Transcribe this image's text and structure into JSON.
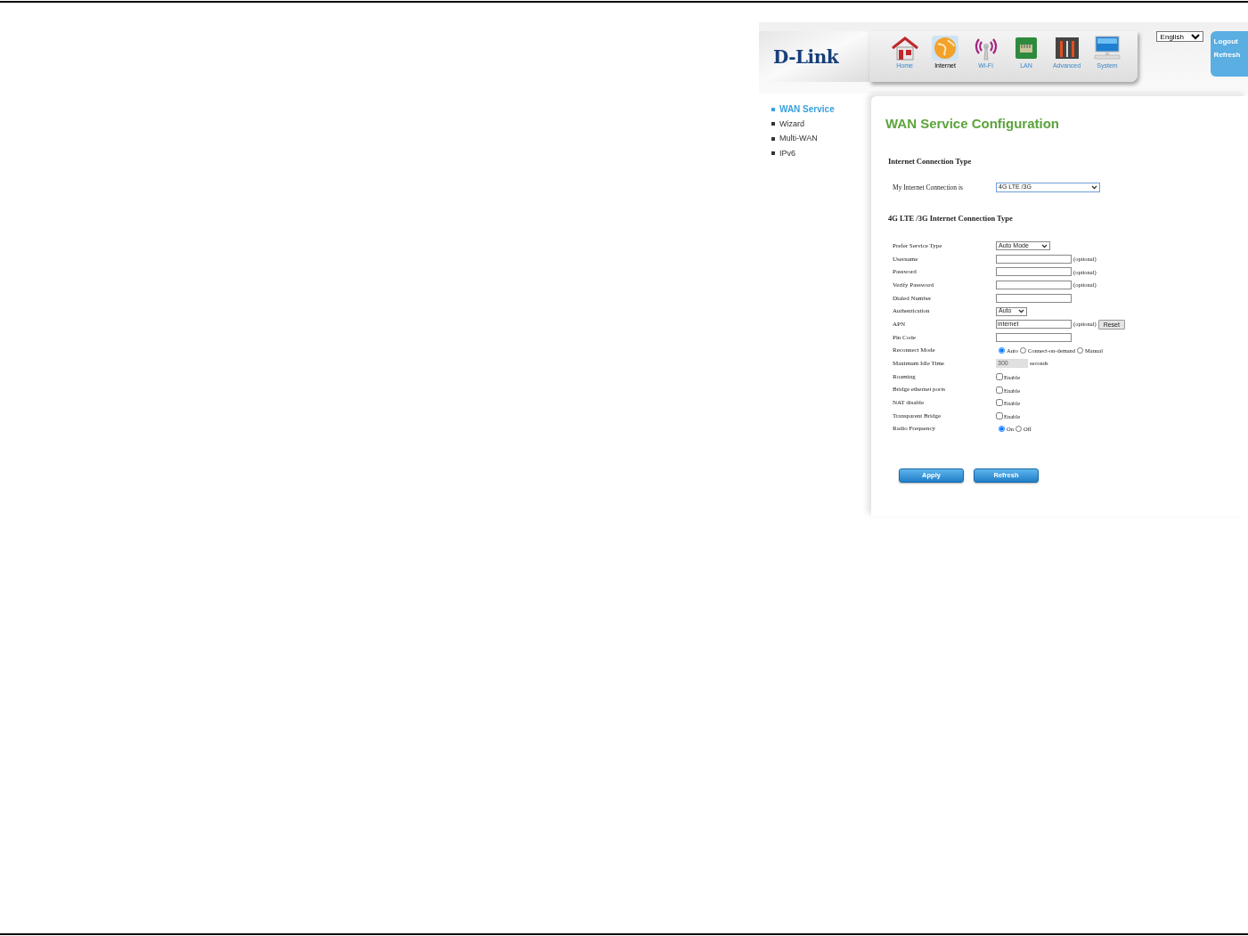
{
  "header": {
    "logo": "D-Link",
    "nav": [
      {
        "label": "Home",
        "selected": false
      },
      {
        "label": "Internet",
        "selected": true
      },
      {
        "label": "Wi-Fi",
        "selected": false
      },
      {
        "label": "LAN",
        "selected": false
      },
      {
        "label": "Advanced",
        "selected": false
      },
      {
        "label": "System",
        "selected": false
      }
    ],
    "language": "English",
    "side_links": [
      "Logout",
      "Refresh"
    ]
  },
  "sidebar": {
    "items": [
      {
        "label": "WAN Service",
        "selected": true
      },
      {
        "label": "Wizard",
        "selected": false
      },
      {
        "label": "Multi-WAN",
        "selected": false
      },
      {
        "label": "IPv6",
        "selected": false
      }
    ]
  },
  "title": "WAN Service Configuration",
  "connection": {
    "heading": "Internet Connection Type",
    "label": "My Internet Connection is",
    "value": "4G LTE /3G"
  },
  "settings": {
    "heading": "4G LTE /3G Internet Connection Type",
    "rows": [
      {
        "kind": "select",
        "label": "Prefer Service Type",
        "value": "Auto Mode"
      },
      {
        "kind": "text",
        "label": "Username",
        "note": "(optional)"
      },
      {
        "kind": "text",
        "label": "Password",
        "note": "(optional)"
      },
      {
        "kind": "text",
        "label": "Verify Password",
        "note": "(optional)"
      },
      {
        "kind": "text",
        "label": "Dialed Number"
      },
      {
        "kind": "select",
        "label": "Authentication",
        "value": "Auto"
      },
      {
        "kind": "text",
        "label": "APN",
        "value": "internet",
        "note": "(optional)",
        "button": "Reset"
      },
      {
        "kind": "text",
        "label": "Pin Code"
      },
      {
        "kind": "radio",
        "label": "Reconnect Mode",
        "options": [
          {
            "label": "Auto",
            "selected": true
          },
          {
            "label": "Connect-on-demand",
            "selected": false
          },
          {
            "label": "Manual",
            "selected": false
          }
        ]
      },
      {
        "kind": "readonly",
        "label": "Maximum Idle Time",
        "value": "300",
        "note": "seconds"
      },
      {
        "kind": "checkbox",
        "label": "Roaming",
        "option": "Enable",
        "checked": false
      },
      {
        "kind": "checkbox",
        "label": "Bridge ethernet ports",
        "option": "Enable",
        "checked": false
      },
      {
        "kind": "checkbox",
        "label": "NAT disable",
        "option": "Enable",
        "checked": false
      },
      {
        "kind": "checkbox",
        "label": "Transparent Bridge",
        "option": "Enable",
        "checked": false
      },
      {
        "kind": "radio",
        "label": "Radio Frequency",
        "options": [
          {
            "label": "On",
            "selected": true
          },
          {
            "label": "Off",
            "selected": false
          }
        ]
      }
    ]
  },
  "buttons": [
    "Apply",
    "Refresh"
  ]
}
